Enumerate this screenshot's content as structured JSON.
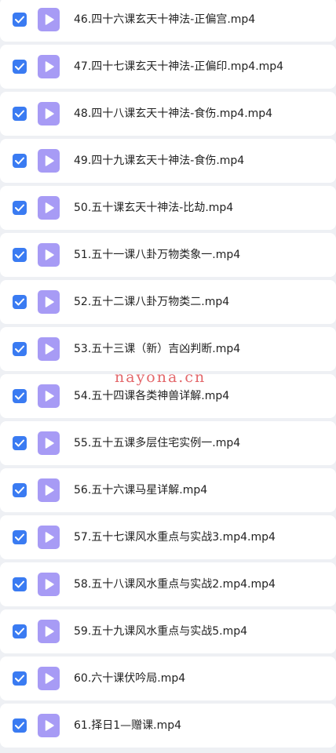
{
  "files": [
    {
      "name": "46.四十六课玄天十神法-正偏宫.mp4",
      "checked": true,
      "icon": "video-file-icon"
    },
    {
      "name": "47.四十七课玄天十神法-正偏印.mp4.mp4",
      "checked": true,
      "icon": "video-file-icon"
    },
    {
      "name": "48.四十八课玄天十神法-食伤.mp4.mp4",
      "checked": true,
      "icon": "video-file-icon"
    },
    {
      "name": "49.四十九课玄天十神法-食伤.mp4",
      "checked": true,
      "icon": "video-file-icon"
    },
    {
      "name": "50.五十课玄天十神法-比劫.mp4",
      "checked": true,
      "icon": "video-file-icon"
    },
    {
      "name": "51.五十一课八卦万物类象一.mp4",
      "checked": true,
      "icon": "video-file-icon"
    },
    {
      "name": "52.五十二课八卦万物类二.mp4",
      "checked": true,
      "icon": "video-file-icon"
    },
    {
      "name": "53.五十三课（新）吉凶判断.mp4",
      "checked": true,
      "icon": "video-file-icon"
    },
    {
      "name": "54.五十四课各类神兽详解.mp4",
      "checked": true,
      "icon": "video-file-icon"
    },
    {
      "name": "55.五十五课多层住宅实例一.mp4",
      "checked": true,
      "icon": "video-file-icon"
    },
    {
      "name": "56.五十六课马星详解.mp4",
      "checked": true,
      "icon": "video-file-icon"
    },
    {
      "name": "57.五十七课风水重点与实战3.mp4.mp4",
      "checked": true,
      "icon": "video-file-icon"
    },
    {
      "name": "58.五十八课风水重点与实战2.mp4.mp4",
      "checked": true,
      "icon": "video-file-icon"
    },
    {
      "name": "59.五十九课风水重点与实战5.mp4",
      "checked": true,
      "icon": "video-file-icon"
    },
    {
      "name": "60.六十课伏吟局.mp4",
      "checked": true,
      "icon": "video-file-icon"
    },
    {
      "name": "61.择日1—赠课.mp4",
      "checked": true,
      "icon": "video-file-icon"
    }
  ],
  "watermark": "nayona.cn",
  "colors": {
    "checkbox": "#3a7bf2",
    "file_icon": "#a79bf5",
    "text": "#222222",
    "background": "#eef0f4",
    "watermark": "#e0565a"
  }
}
